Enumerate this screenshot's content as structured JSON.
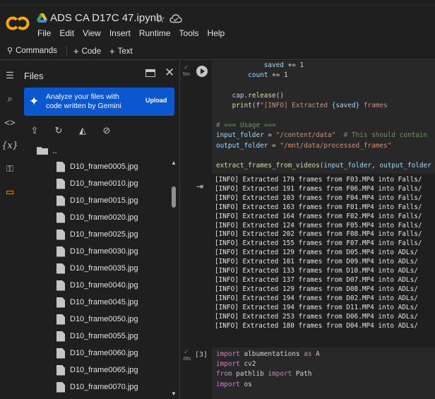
{
  "header": {
    "title": "ADS CA D17C 47.ipynb",
    "menu": [
      "File",
      "Edit",
      "View",
      "Insert",
      "Runtime",
      "Tools",
      "Help"
    ]
  },
  "toolbar": {
    "commands_label": "Commands",
    "code_label": "Code",
    "text_label": "Text"
  },
  "files_panel": {
    "title": "Files",
    "gemini_text": "Analyze your files with code written by Gemini",
    "upload_label": "Upload",
    "parent_label": "..",
    "files": [
      "D10_frame0005.jpg",
      "D10_frame0010.jpg",
      "D10_frame0015.jpg",
      "D10_frame0020.jpg",
      "D10_frame0025.jpg",
      "D10_frame0030.jpg",
      "D10_frame0035.jpg",
      "D10_frame0040.jpg",
      "D10_frame0045.jpg",
      "D10_frame0050.jpg",
      "D10_frame0055.jpg",
      "D10_frame0060.jpg",
      "D10_frame0065.jpg",
      "D10_frame0070.jpg"
    ]
  },
  "cell1": {
    "exec_time": "5m",
    "code_lines": [
      "            saved += 1",
      "        count += 1",
      "",
      "    cap.release()",
      "    print(f\"[INFO] Extracted {saved} frames",
      "",
      "# === Usage ===",
      "input_folder = \"/content/data\"  # This should contain",
      "output_folder = \"/mnt/data/processed_frames\"",
      "",
      "extract_frames_from_videos(input_folder, output_folder"
    ]
  },
  "output1": {
    "lines": [
      "[INFO] Extracted 179 frames from F03.MP4 into Falls/",
      "[INFO] Extracted 191 frames from F06.MP4 into Falls/",
      "[INFO] Extracted 103 frames from F04.MP4 into Falls/",
      "[INFO] Extracted 163 frames from F01.MP4 into Falls/",
      "[INFO] Extracted 164 frames from F02.MP4 into Falls/",
      "[INFO] Extracted 124 frames from F05.MP4 into Falls/",
      "[INFO] Extracted 202 frames from F08.MP4 into Falls/",
      "[INFO] Extracted 155 frames from F07.MP4 into Falls/",
      "[INFO] Extracted 129 frames from D05.MP4 into ADLs/",
      "[INFO] Extracted 101 frames from D09.MP4 into ADLs/",
      "[INFO] Extracted 133 frames from D10.MP4 into ADLs/",
      "[INFO] Extracted 137 frames from D07.MP4 into ADLs/",
      "[INFO] Extracted 129 frames from D08.MP4 into ADLs/",
      "[INFO] Extracted 194 frames from D02.MP4 into ADLs/",
      "[INFO] Extracted 194 frames from D11.MP4 into ADLs/",
      "[INFO] Extracted 253 frames from D06.MP4 into ADLs/",
      "[INFO] Extracted 180 frames from D04.MP4 into ADLs/"
    ]
  },
  "cell2": {
    "exec_count": "[3]",
    "exec_time": "28s",
    "code_lines": [
      "import albumentations as A",
      "import cv2",
      "from pathlib import Path",
      "import os"
    ]
  },
  "colors": {
    "background": "#1f1f1f",
    "cell_bg": "#282828",
    "accent": "#0b57d0",
    "logo_orange": "#f9ab00",
    "success": "#34a853"
  },
  "icons": {
    "rail": [
      "table-of-contents-icon",
      "find-icon",
      "code-snippets-icon",
      "variables-icon",
      "secrets-key-icon",
      "files-folder-icon"
    ],
    "file_actions": [
      "upload-file-icon",
      "refresh-icon",
      "mount-drive-icon",
      "hide-files-icon"
    ]
  }
}
